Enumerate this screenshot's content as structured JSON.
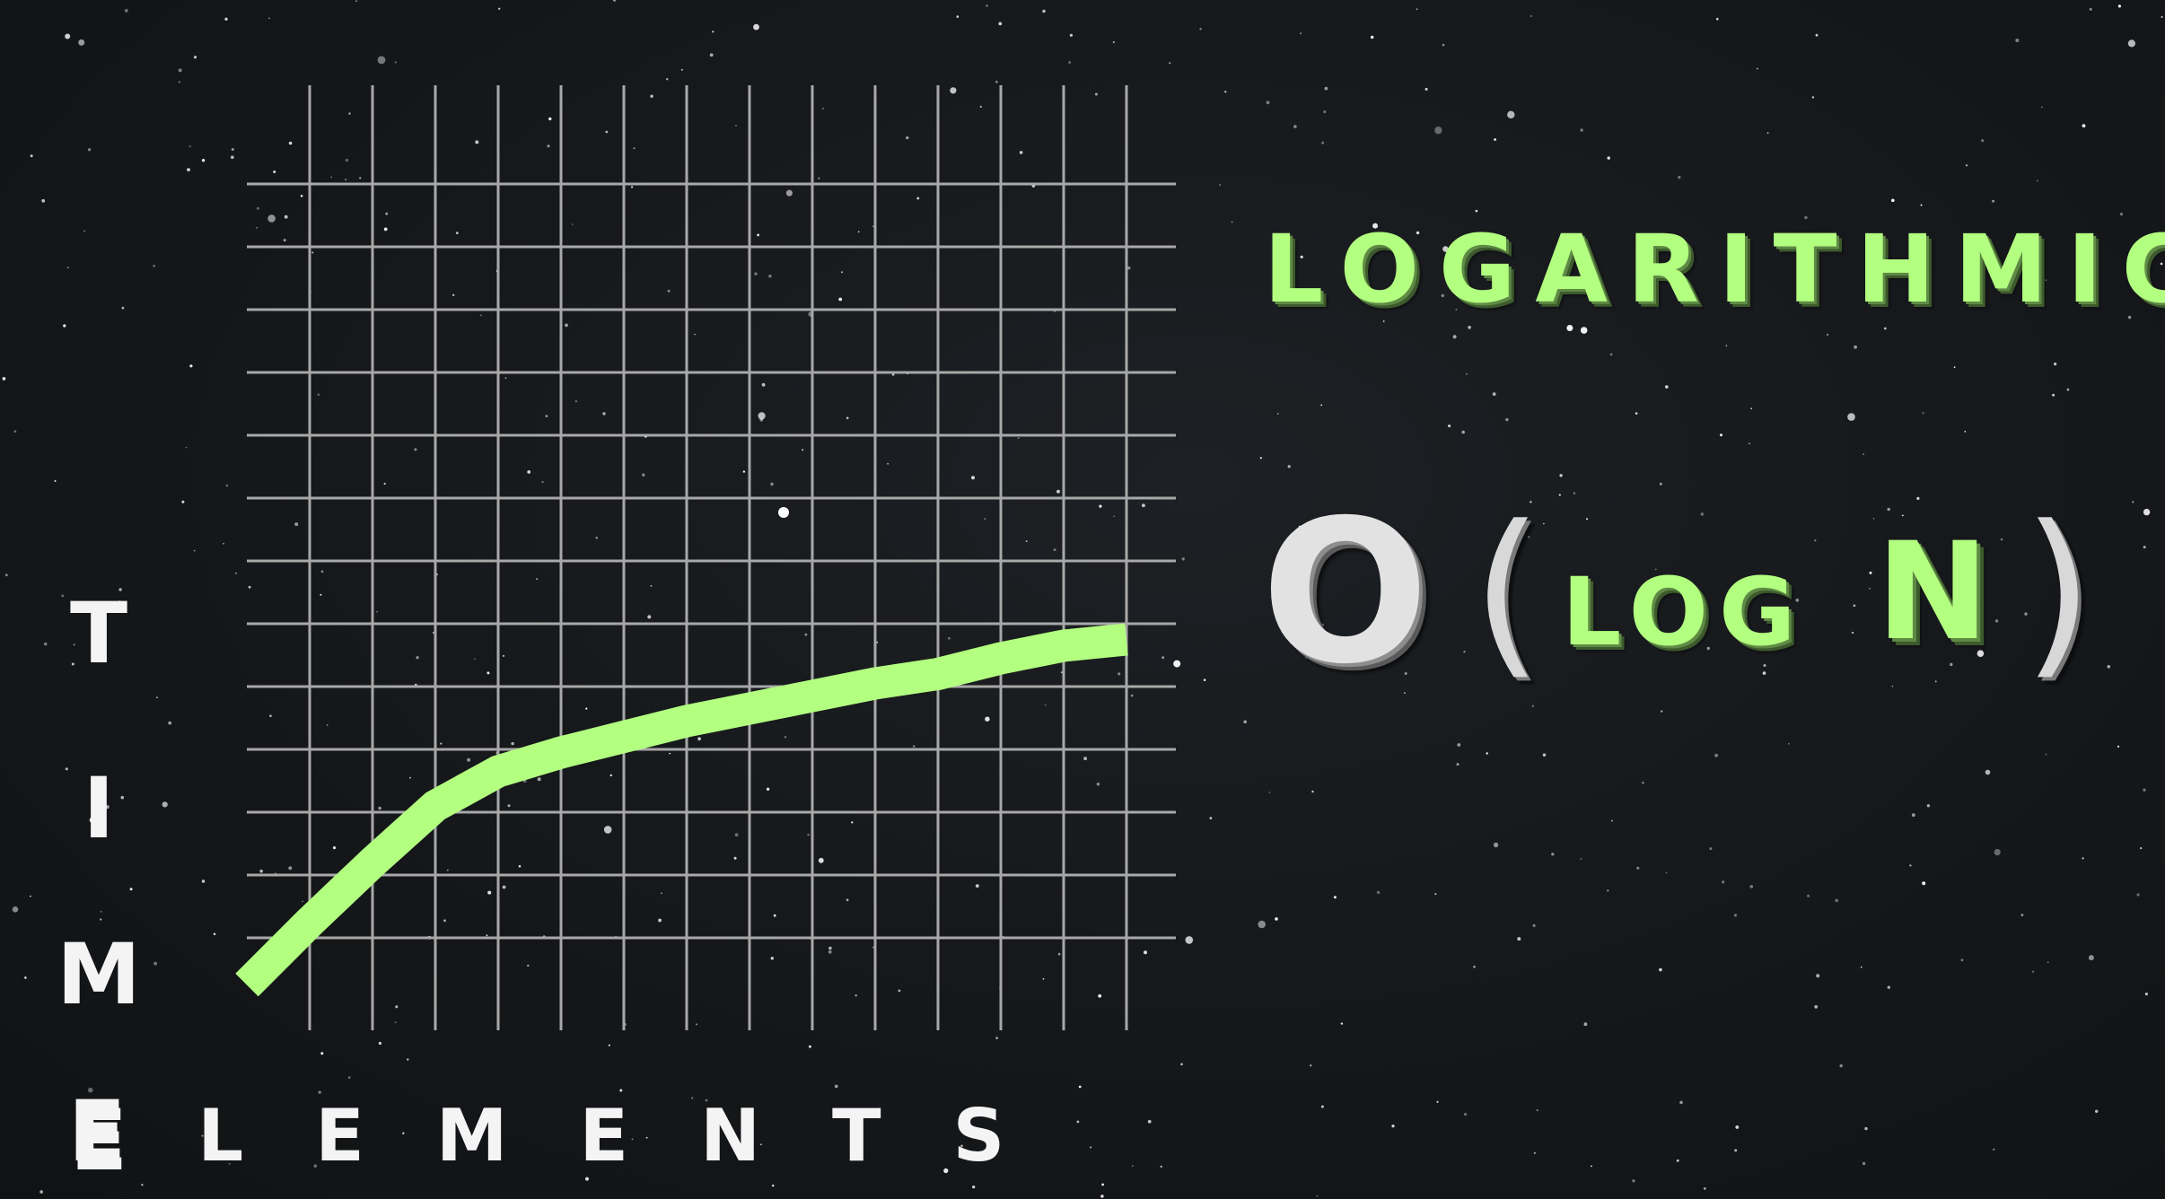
{
  "chart_data": {
    "type": "line",
    "title": "LOGARITHMIC",
    "notation": {
      "big_o": "O",
      "open_paren": "(",
      "log": "LOG",
      "n": "N",
      "close_paren": ")"
    },
    "xlabel": "ELEMENTS",
    "ylabel": "TIME",
    "grid": true,
    "line_color": "#b3ff80",
    "grid_color": "#a8a8a8",
    "series": [
      {
        "x": [
          0,
          1,
          2,
          3,
          4,
          5,
          6,
          7,
          8,
          9,
          10,
          11,
          12,
          13,
          14
        ],
        "y": [
          0.25,
          1.25,
          2.2,
          3.1,
          3.65,
          3.95,
          4.2,
          4.45,
          4.65,
          4.85,
          5.05,
          5.2,
          5.45,
          5.65,
          5.75
        ]
      }
    ],
    "xlim": [
      0,
      14.6
    ],
    "ylim": [
      0,
      14.5
    ]
  }
}
